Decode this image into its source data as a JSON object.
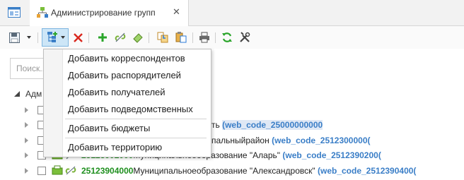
{
  "tabs": {
    "home_icon": "window-icon",
    "active": {
      "label": "Администрирование групп",
      "icon": "hierarchy-icon",
      "close": "✕"
    }
  },
  "toolbar": {
    "buttons": [
      "save-icon",
      "dropdown-arrow",
      "add-hierarchy-icon",
      "delete-icon",
      "add-icon",
      "unlink-icon",
      "eraser-icon",
      "copy-icon",
      "paste-icon",
      "print-icon",
      "refresh-icon",
      "tools-icon"
    ]
  },
  "search": {
    "placeholder": "Поиск..."
  },
  "tree": {
    "root_label": "Адм",
    "rows": [
      {
        "code": "",
        "name": "ть",
        "web": "(web_code_25000000000"
      },
      {
        "code": "",
        "name": "пальныйрайон",
        "web": "(web_code_2512300000("
      },
      {
        "code": "25123902000",
        "name": "Муниципальноеобразование \"Аларь\"",
        "web": "(web_code_2512390200("
      },
      {
        "code": "25123904000",
        "name": "Муниципальноеобразование \"Александровск\"",
        "web": "(web_code_2512390400("
      }
    ]
  },
  "menu": {
    "items": [
      "Добавить корреспондентов",
      "Добавить распорядителей",
      "Добавить получателей",
      "Добавить подведомственных",
      "Добавить бюджеты",
      "Добавить территорию"
    ]
  },
  "colors": {
    "accent": "#3a7ec7",
    "code_green": "#1e8f1e",
    "selection": "#cde6f7"
  }
}
